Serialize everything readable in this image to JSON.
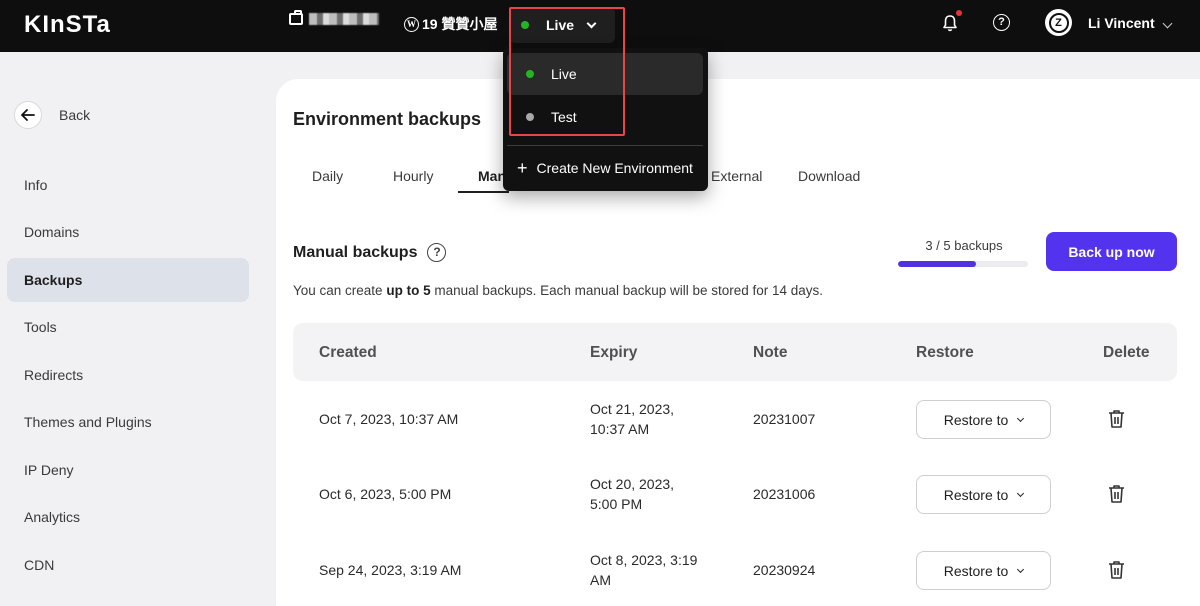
{
  "topbar": {
    "logo": "KInSTa",
    "site_label": "19 贊贊小屋",
    "environment": "Live",
    "user_name": "Li Vincent",
    "avatar_initial": "Z",
    "help_glyph": "?",
    "wp_glyph": "W"
  },
  "env_dropdown": {
    "items": [
      {
        "label": "Live",
        "status_color": "#24b524",
        "selected": true
      },
      {
        "label": "Test",
        "status_color": "#a8a8a8",
        "selected": false
      }
    ],
    "create_label": "Create New Environment"
  },
  "sidebar": {
    "back_label": "Back",
    "items": [
      "Info",
      "Domains",
      "Backups",
      "Tools",
      "Redirects",
      "Themes and Plugins",
      "IP Deny",
      "Analytics",
      "CDN"
    ],
    "active": "Backups"
  },
  "main": {
    "title": "Environment backups",
    "tabs": [
      "Daily",
      "Hourly",
      "Man",
      "External",
      "Download"
    ],
    "active_tab": "Manual",
    "section_title": "Manual backups",
    "description_prefix": "You can create ",
    "description_bold": "up to 5",
    "description_suffix": " manual backups. Each manual backup will be stored for 14 days.",
    "backup_count": "3 / 5 backups",
    "backup_fraction": 0.6,
    "backup_button": "Back up now",
    "table": {
      "headers": [
        "Created",
        "Expiry",
        "Note",
        "Restore",
        "Delete"
      ],
      "restore_label": "Restore to",
      "rows": [
        {
          "created": "Oct 7, 2023, 10:37 AM",
          "expiry_line1": "Oct 21, 2023,",
          "expiry_line2": "10:37 AM",
          "note": "20231007"
        },
        {
          "created": "Oct 6, 2023, 5:00 PM",
          "expiry_line1": "Oct 20, 2023,",
          "expiry_line2": "5:00 PM",
          "note": "20231006"
        },
        {
          "created": "Sep 24, 2023, 3:19 AM",
          "expiry_line1": "Oct 8, 2023, 3:19",
          "expiry_line2": "AM",
          "note": "20230924"
        }
      ]
    }
  },
  "colors": {
    "accent": "#5333ed",
    "topbar": "#0e0e0e",
    "highlight": "#e5464b",
    "live": "#24b524",
    "notification": "#e5323b"
  }
}
